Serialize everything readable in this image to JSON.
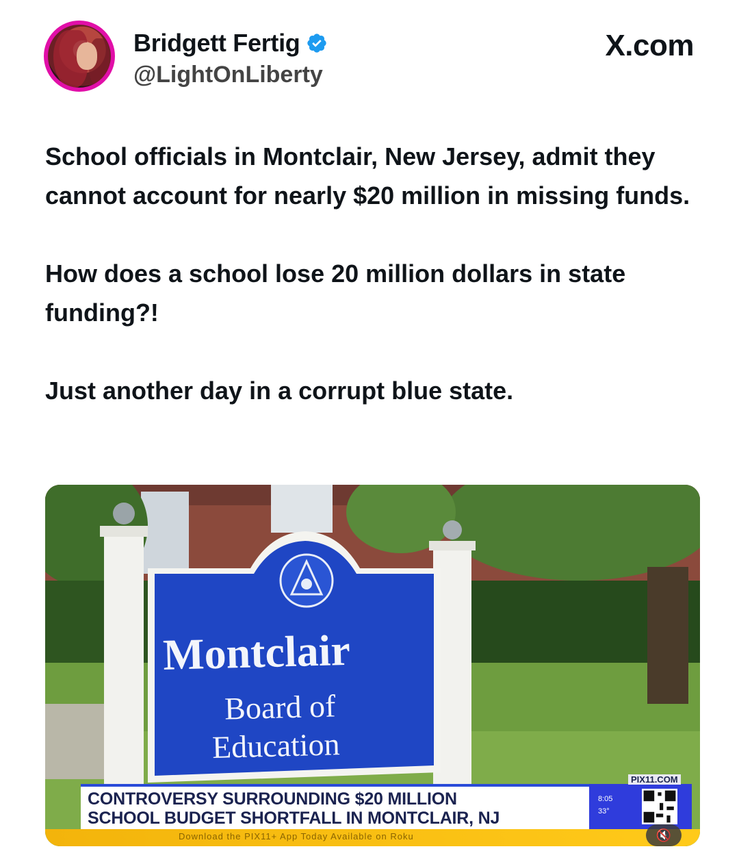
{
  "author": {
    "display_name": "Bridgett Fertig",
    "handle": "@LightOnLiberty",
    "verified": true,
    "badge_color": "#1d9bf0",
    "avatar_ring_color": "#e10fa8"
  },
  "site_label": "X.com",
  "post": {
    "paragraphs": [
      "School officials in Montclair, New Jersey, admit they cannot account for nearly $20 million in missing funds.",
      "How does a school lose 20 million dollars in state funding?!",
      "Just another day in a corrupt blue state."
    ]
  },
  "media": {
    "sign_title": "Montclair",
    "sign_line_1": "Board of",
    "sign_line_2": "Education",
    "chyron_line_1": "CONTROVERSY SURROUNDING $20 MILLION",
    "chyron_line_2": "SCHOOL BUDGET SHORTFALL IN MONTCLAIR, NJ",
    "station_url": "PIX11.COM",
    "time": "8:05",
    "temperature": "33°",
    "ticker_text": "Download the PIX11+ App Today   Available on Roku",
    "mute_icon": "speaker-muted-icon"
  }
}
